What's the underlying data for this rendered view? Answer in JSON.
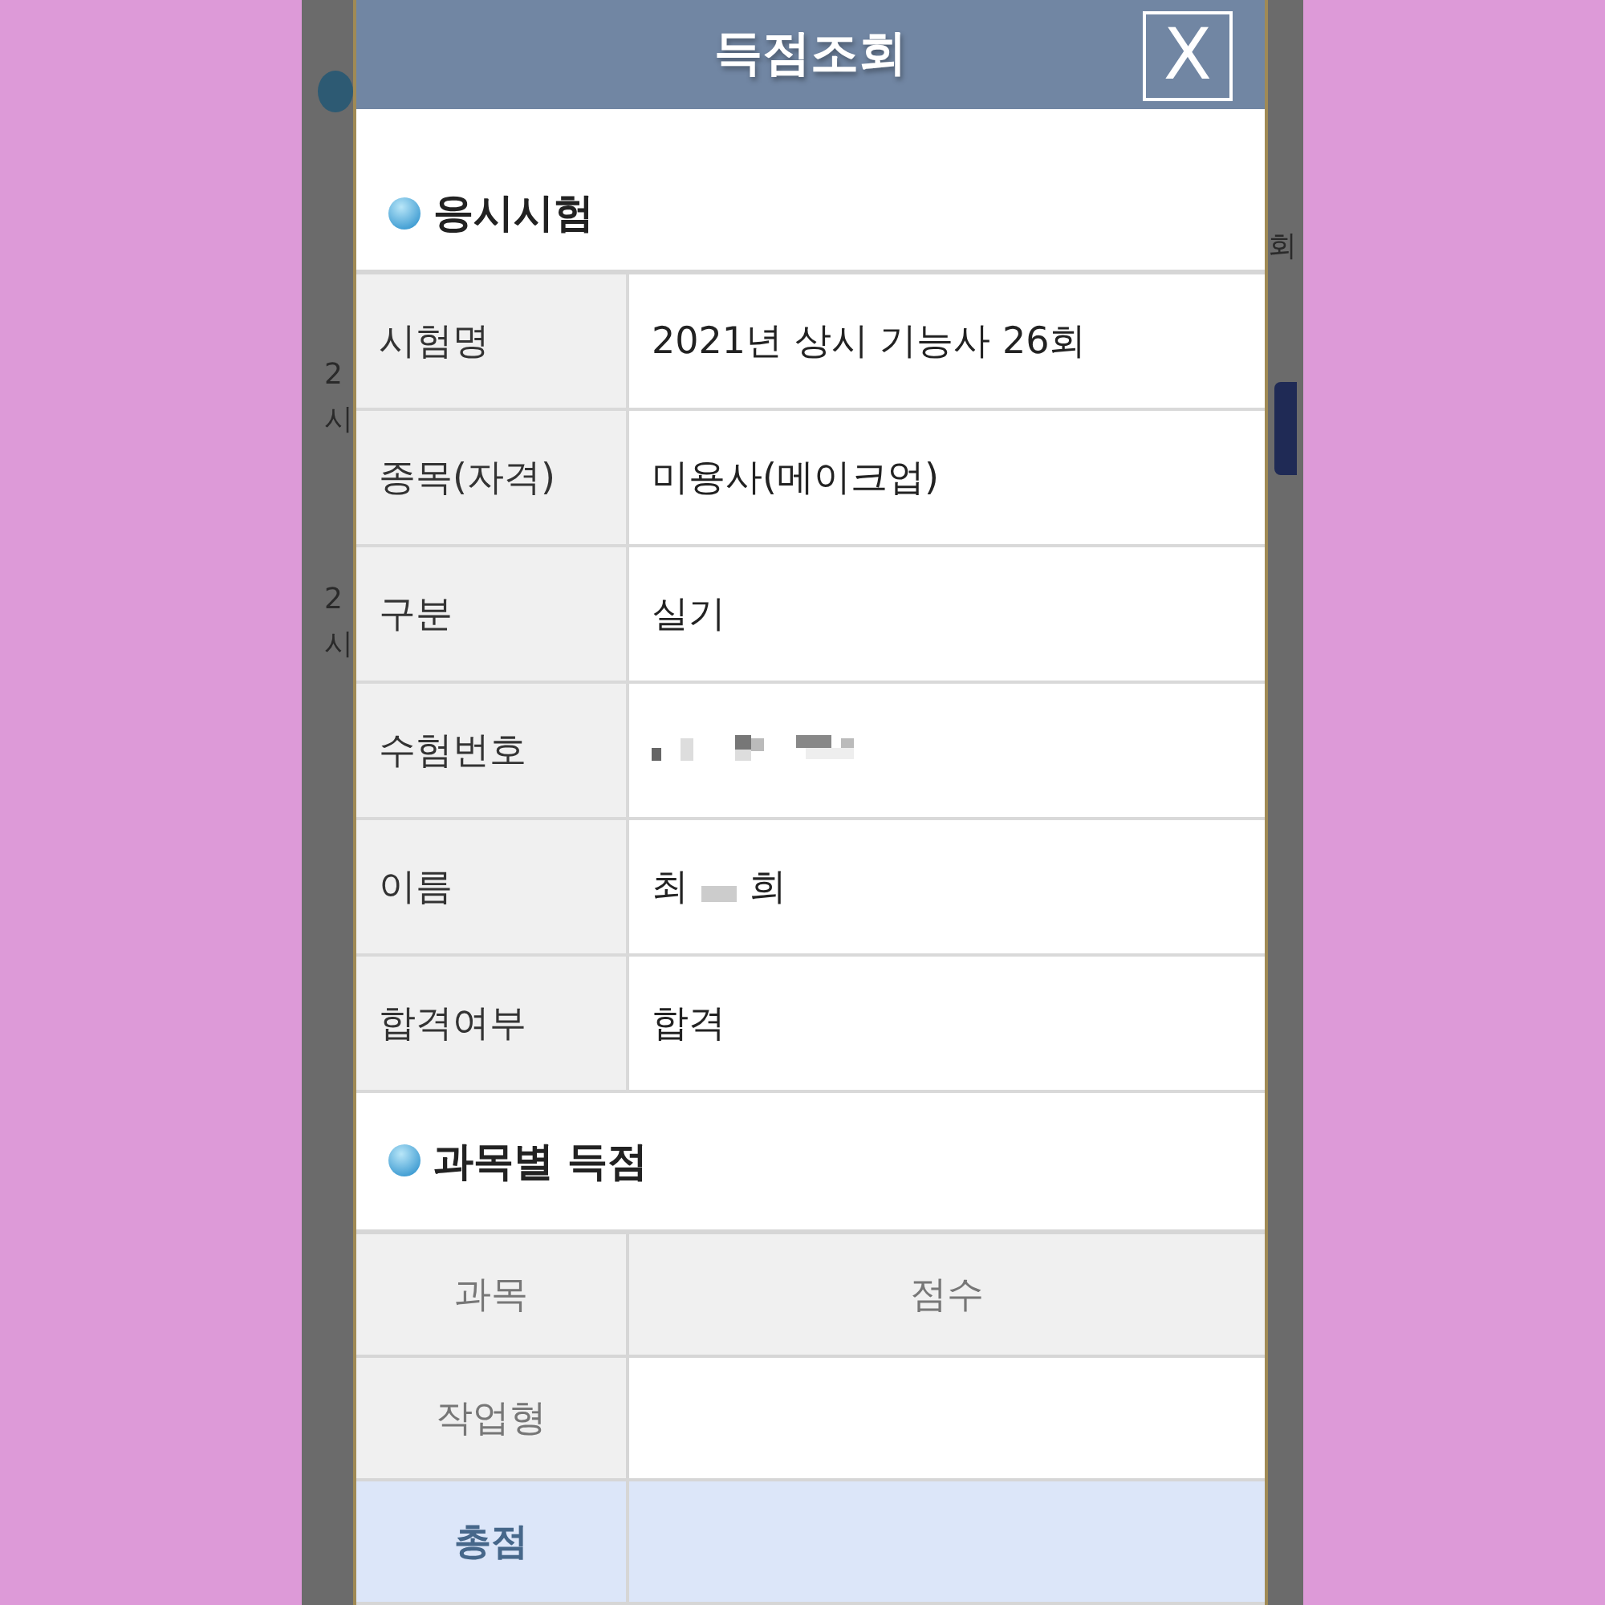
{
  "background_page": {
    "left_fragments": [
      "2",
      "시",
      "2",
      "시"
    ],
    "right_fragments": [
      "회"
    ]
  },
  "dialog": {
    "title": "득점조회",
    "close_label": "X",
    "sections": [
      {
        "heading": "응시시험",
        "kind": "info",
        "rows": [
          {
            "label": "시험명",
            "value": "2021년 상시 기능사 26회"
          },
          {
            "label": "종목(자격)",
            "value": "미용사(메이크업)"
          },
          {
            "label": "구분",
            "value": "실기"
          },
          {
            "label": "수험번호",
            "redacted": true
          },
          {
            "label": "이름",
            "value_parts": [
              {
                "kind": "text",
                "text": "최"
              },
              {
                "kind": "redacted"
              },
              {
                "kind": "text",
                "text": "희"
              }
            ]
          },
          {
            "label": "합격여부",
            "value": "합격"
          }
        ]
      },
      {
        "heading": "과목별 득점",
        "kind": "scores",
        "columns": [
          "과목",
          "점수"
        ],
        "rows": [
          {
            "subject": "작업형",
            "total": false
          },
          {
            "subject": "총점",
            "total": true
          }
        ]
      }
    ]
  }
}
